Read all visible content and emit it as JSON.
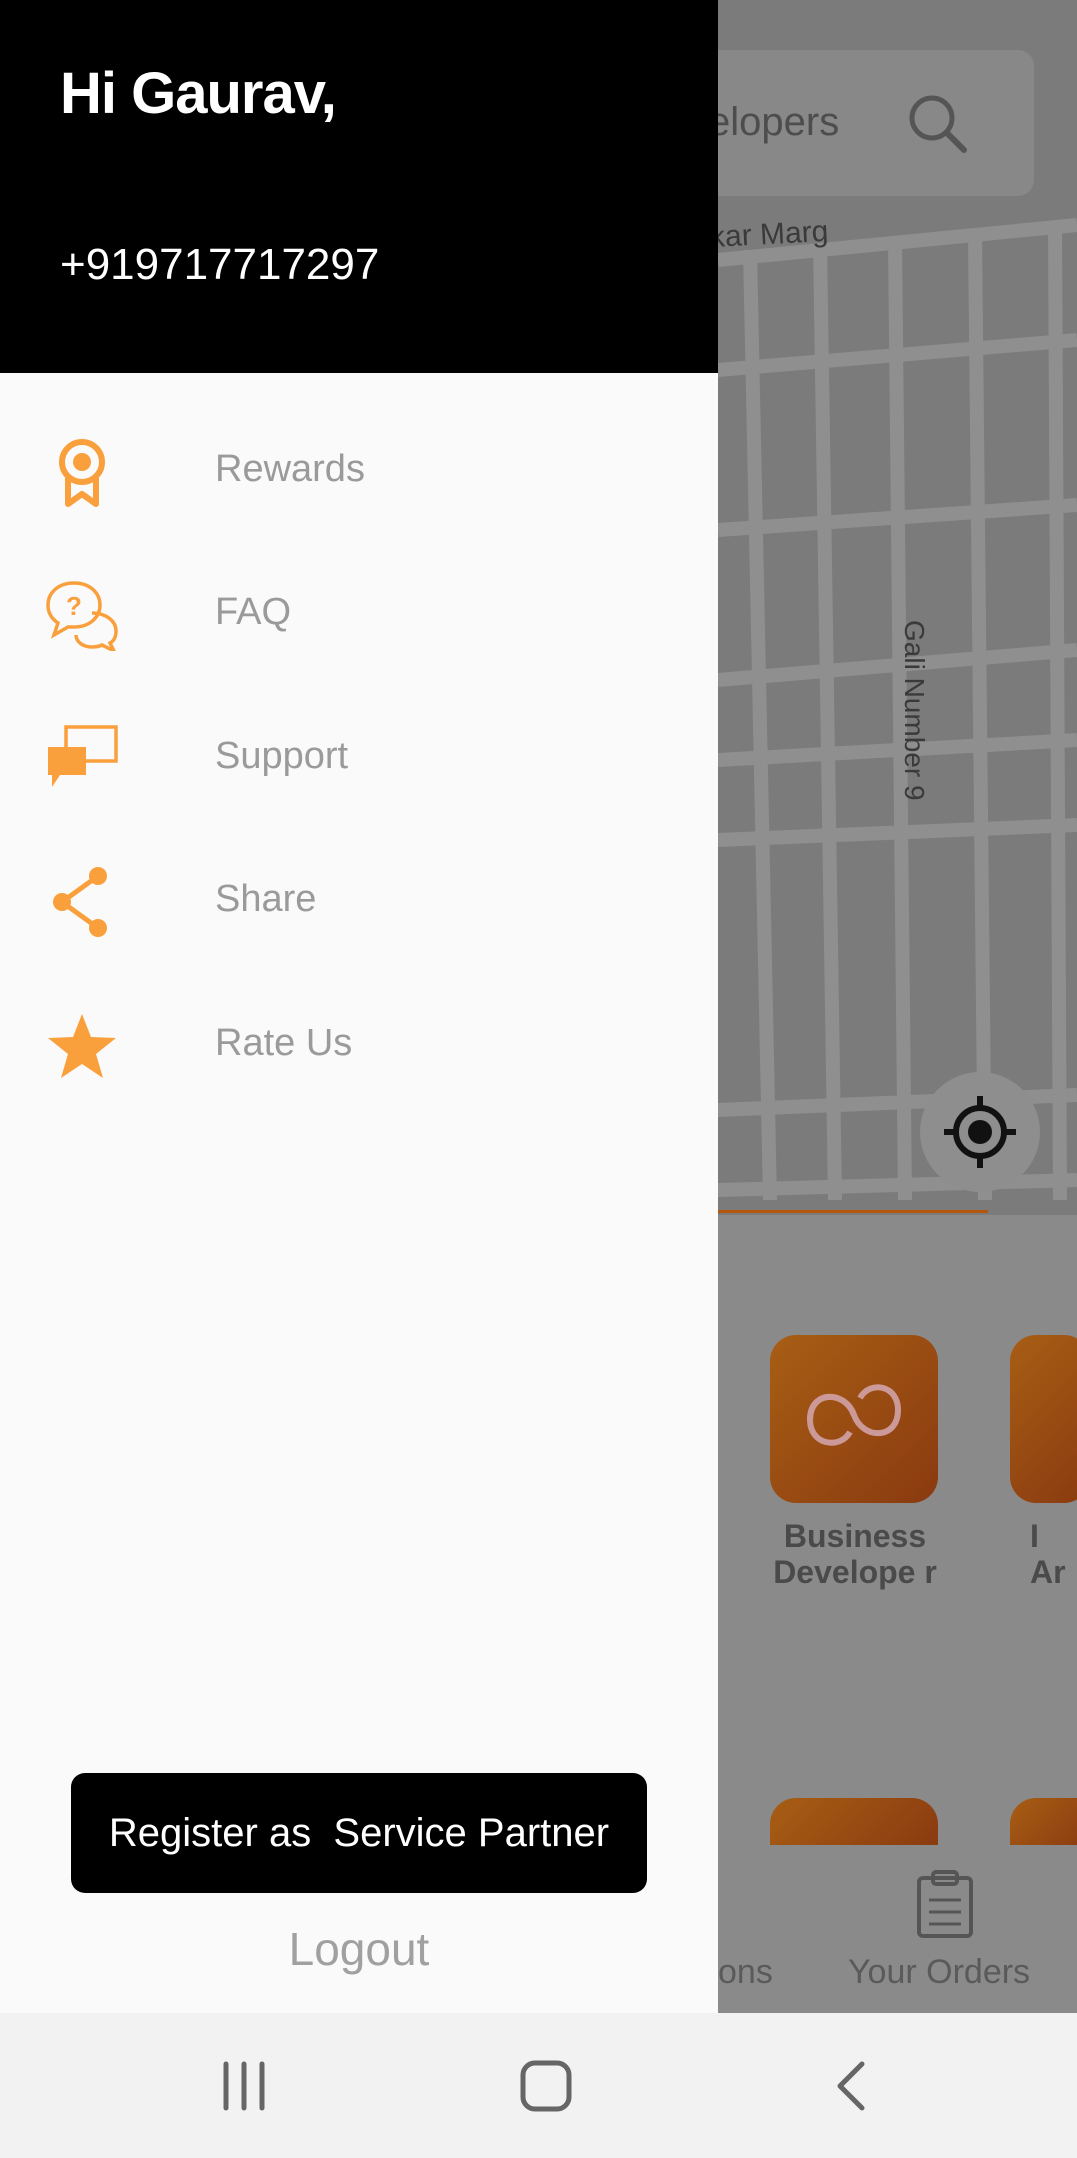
{
  "drawer": {
    "greeting": "Hi Gaurav,",
    "phone": "+919717717297",
    "menu": [
      {
        "label": "Rewards",
        "icon": "award-ribbon-icon"
      },
      {
        "label": "FAQ",
        "icon": "faq-chat-icon"
      },
      {
        "label": "Support",
        "icon": "support-chat-icon"
      },
      {
        "label": "Share",
        "icon": "share-icon"
      },
      {
        "label": "Rate Us",
        "icon": "star-icon"
      }
    ],
    "register_label": "Register as  Service Partner",
    "logout_label": "Logout"
  },
  "background": {
    "search_text": "elopers",
    "street_1": "kar Marg",
    "street_2": "Gali Number 9",
    "tile_label": "Business Develope r",
    "tile_label_2": "I Ar",
    "nav_partial": "ons",
    "nav_orders": "Your Orders"
  },
  "colors": {
    "accent": "#F9A03C",
    "drawer_header": "#000000",
    "menu_text": "#9A9A9A"
  }
}
